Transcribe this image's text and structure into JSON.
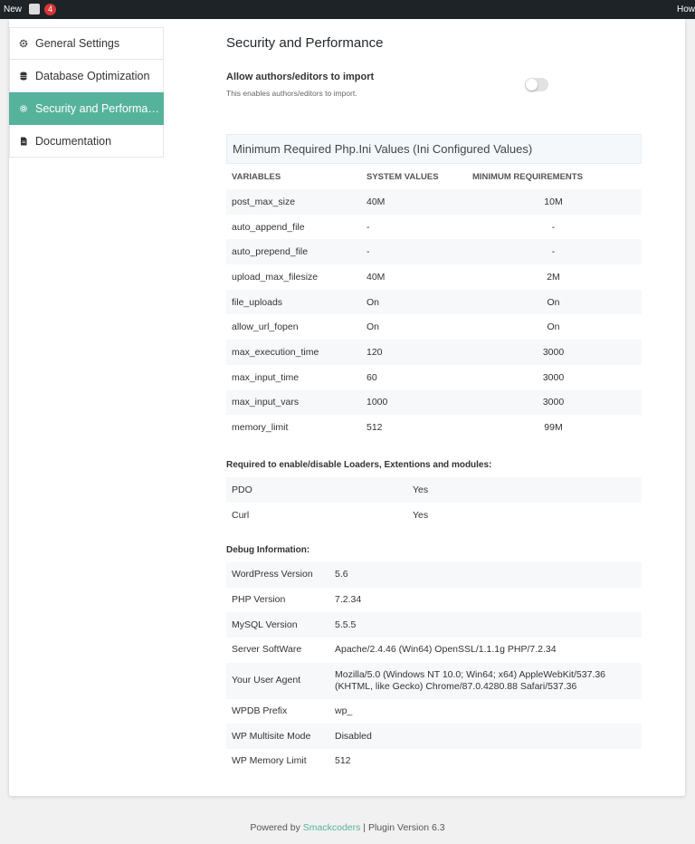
{
  "adminbar": {
    "new_label": "New",
    "notifications_count": "4",
    "howdy": "How"
  },
  "sidebar": {
    "items": [
      {
        "label": "General Settings",
        "icon": "gear-icon"
      },
      {
        "label": "Database Optimization",
        "icon": "database-icon"
      },
      {
        "label": "Security and Performance",
        "icon": "gear-icon"
      },
      {
        "label": "Documentation",
        "icon": "document-icon"
      }
    ],
    "active_color": "#56b39b"
  },
  "main": {
    "title": "Security and Performance",
    "allow_import": {
      "label": "Allow authors/editors to import",
      "description": "This enables authors/editors to import.",
      "enabled": false
    },
    "ini": {
      "heading": "Minimum Required Php.Ini Values (Ini Configured Values)",
      "columns": [
        "VARIABLES",
        "SYSTEM VALUES",
        "MINIMUM REQUIREMENTS"
      ],
      "rows": [
        [
          "post_max_size",
          "40M",
          "10M"
        ],
        [
          "auto_append_file",
          "-",
          "-"
        ],
        [
          "auto_prepend_file",
          "-",
          "-"
        ],
        [
          "upload_max_filesize",
          "40M",
          "2M"
        ],
        [
          "file_uploads",
          "On",
          "On"
        ],
        [
          "allow_url_fopen",
          "On",
          "On"
        ],
        [
          "max_execution_time",
          "120",
          "3000"
        ],
        [
          "max_input_time",
          "60",
          "3000"
        ],
        [
          "max_input_vars",
          "1000",
          "3000"
        ],
        [
          "memory_limit",
          "512",
          "99M"
        ]
      ]
    },
    "modules": {
      "heading": "Required to enable/disable Loaders, Extentions and modules:",
      "rows": [
        [
          "PDO",
          "Yes"
        ],
        [
          "Curl",
          "Yes"
        ]
      ]
    },
    "debug": {
      "heading": "Debug Information:",
      "rows": [
        [
          "WordPress Version",
          "5.6"
        ],
        [
          "PHP Version",
          "7.2.34"
        ],
        [
          "MySQL Version",
          "5.5.5"
        ],
        [
          "Server SoftWare",
          "Apache/2.4.46 (Win64) OpenSSL/1.1.1g PHP/7.2.34"
        ],
        [
          "Your User Agent",
          "Mozilla/5.0 (Windows NT 10.0; Win64; x64) AppleWebKit/537.36 (KHTML, like Gecko) Chrome/87.0.4280.88 Safari/537.36"
        ],
        [
          "WPDB Prefix",
          "wp_"
        ],
        [
          "WP Multisite Mode",
          "Disabled"
        ],
        [
          "WP Memory Limit",
          "512"
        ]
      ]
    }
  },
  "footer": {
    "prefix": "Powered by",
    "brand": "Smackcoders",
    "suffix": "| Plugin Version 6.3"
  }
}
